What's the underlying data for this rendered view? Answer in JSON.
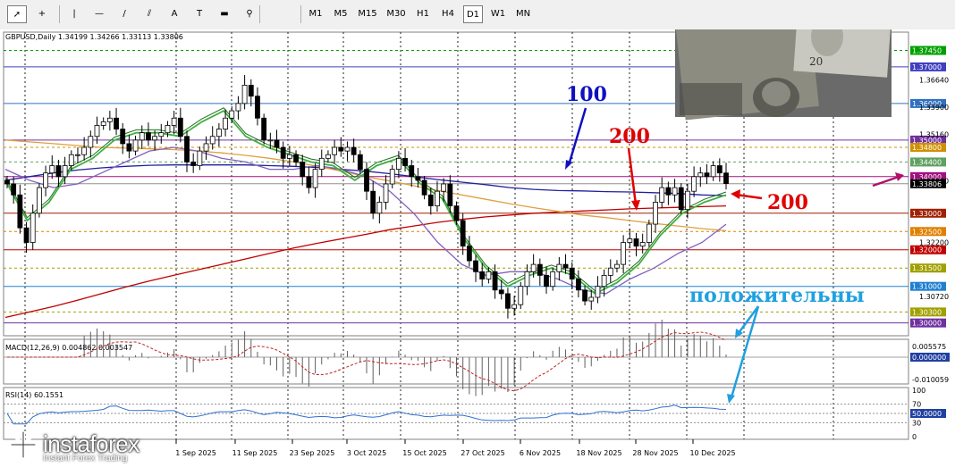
{
  "toolbar": {
    "tools": [
      {
        "name": "cursor-tool",
        "glyph": "➚"
      },
      {
        "name": "crosshair-tool",
        "glyph": "+"
      },
      {
        "name": "vertical-line-tool",
        "glyph": "|"
      },
      {
        "name": "horizontal-line-tool",
        "glyph": "—"
      },
      {
        "name": "trendline-tool",
        "glyph": "/"
      },
      {
        "name": "channel-tool",
        "glyph": "⫽"
      },
      {
        "name": "text-tool",
        "glyph": "A"
      },
      {
        "name": "text-label-tool",
        "glyph": "T"
      },
      {
        "name": "arrow-shapes-tool",
        "glyph": "▬"
      },
      {
        "name": "more-shapes-tool",
        "glyph": "⚲"
      }
    ],
    "timeframes": [
      "M1",
      "M5",
      "M15",
      "M30",
      "H1",
      "H4",
      "D1",
      "W1",
      "MN"
    ],
    "active_timeframe": "D1"
  },
  "header": {
    "symbol_line": "GBPUSD,Daily  1.34199 1.34266 1.33113 1.33806"
  },
  "macd_label": "MACD(12,26,9) 0.004862 0.003547",
  "rsi_label": "RSI(14) 60.1551",
  "annotations": {
    "ma100": "100",
    "ma200_top": "200",
    "ma200_right": "200",
    "positive": "положительны"
  },
  "watermark": {
    "brand": "instaforex",
    "tagline": "Instant Forex Trading"
  },
  "chart_data": {
    "type": "candlestick",
    "symbol": "GBPUSD",
    "timeframe": "Daily",
    "last_ohlc": {
      "open": 1.34199,
      "high": 1.34266,
      "low": 1.33113,
      "close": 1.33806
    },
    "x_tick_labels": [
      "1 Sep 2025",
      "11 Sep 2025",
      "23 Sep 2025",
      "3 Oct 2025",
      "15 Oct 2025",
      "27 Oct 2025",
      "6 Nov 2025",
      "18 Nov 2025",
      "28 Nov 2025",
      "10 Dec 2025"
    ],
    "y_tick_labels": [
      "1.36640",
      "1.33900",
      "1.35160",
      "1.33880",
      "1.32200",
      "1.30720"
    ],
    "ylim": [
      1.2965,
      1.3795
    ],
    "horizontal_levels": [
      {
        "price": 1.3745,
        "label": "1.37450",
        "color": "#00a000",
        "style": "dash"
      },
      {
        "price": 1.37,
        "label": "1.37000",
        "color": "#4040c0",
        "style": "solid"
      },
      {
        "price": 1.36,
        "label": "1.36000",
        "color": "#3070c0",
        "style": "solid"
      },
      {
        "price": 1.35,
        "label": "1.35000",
        "color": "#7030a0",
        "style": "solid"
      },
      {
        "price": 1.348,
        "label": "1.34800",
        "color": "#d09000",
        "style": "dash"
      },
      {
        "price": 1.344,
        "label": "1.34400",
        "color": "#60a060",
        "style": "dash"
      },
      {
        "price": 1.34,
        "label": "1.34000",
        "color": "#a01080",
        "style": "solid"
      },
      {
        "price": 1.33,
        "label": "1.33000",
        "color": "#a02000",
        "style": "solid"
      },
      {
        "price": 1.325,
        "label": "1.32500",
        "color": "#e08000",
        "style": "dash"
      },
      {
        "price": 1.32,
        "label": "1.32000",
        "color": "#c00000",
        "style": "solid"
      },
      {
        "price": 1.315,
        "label": "1.31500",
        "color": "#a0a000",
        "style": "dash"
      },
      {
        "price": 1.31,
        "label": "1.31000",
        "color": "#2080d0",
        "style": "solid"
      },
      {
        "price": 1.303,
        "label": "1.30300",
        "color": "#a0a000",
        "style": "dash"
      },
      {
        "price": 1.3,
        "label": "1.30000",
        "color": "#7030a0",
        "style": "solid"
      }
    ],
    "current_price": {
      "price": 1.33806,
      "label": "1.33806"
    },
    "close_series": [
      1.338,
      1.335,
      1.326,
      1.322,
      1.33,
      1.337,
      1.341,
      1.343,
      1.34,
      1.343,
      1.346,
      1.346,
      1.348,
      1.351,
      1.354,
      1.355,
      1.356,
      1.353,
      1.349,
      1.347,
      1.35,
      1.352,
      1.35,
      1.351,
      1.352,
      1.354,
      1.356,
      1.351,
      1.344,
      1.343,
      1.347,
      1.349,
      1.351,
      1.353,
      1.356,
      1.358,
      1.36,
      1.365,
      1.362,
      1.356,
      1.35,
      1.35,
      1.348,
      1.345,
      1.346,
      1.344,
      1.34,
      1.337,
      1.342,
      1.345,
      1.346,
      1.348,
      1.347,
      1.348,
      1.346,
      1.342,
      1.336,
      1.33,
      1.333,
      1.338,
      1.342,
      1.345,
      1.343,
      1.34,
      1.339,
      1.335,
      1.332,
      1.336,
      1.338,
      1.332,
      1.328,
      1.321,
      1.317,
      1.314,
      1.312,
      1.314,
      1.309,
      1.308,
      1.304,
      1.305,
      1.31,
      1.314,
      1.316,
      1.313,
      1.31,
      1.314,
      1.316,
      1.315,
      1.312,
      1.309,
      1.306,
      1.307,
      1.31,
      1.313,
      1.315,
      1.316,
      1.322,
      1.323,
      1.321,
      1.322,
      1.327,
      1.333,
      1.337,
      1.335,
      1.337,
      1.331,
      1.336,
      1.34,
      1.341,
      1.34,
      1.343,
      1.341,
      1.3381
    ],
    "series": [
      {
        "name": "",
        "color": "#2020a0",
        "values": [
          1.339,
          1.34,
          1.341,
          1.3418,
          1.3424,
          1.3428,
          1.3431,
          1.3432,
          1.3432,
          1.3432,
          1.3432,
          1.343,
          1.3428,
          1.3425,
          1.342,
          1.3415,
          1.3408,
          1.34,
          1.3392,
          1.3385,
          1.3378,
          1.337,
          1.3365,
          1.3362,
          1.3361,
          1.3359,
          1.3358,
          1.3356,
          1.3354,
          1.335,
          1.3348
        ]
      },
      {
        "name": "",
        "color": "#c00000",
        "values": [
          1.3015,
          1.303,
          1.3045,
          1.3062,
          1.308,
          1.3098,
          1.3115,
          1.313,
          1.3145,
          1.316,
          1.3175,
          1.319,
          1.3205,
          1.3218,
          1.323,
          1.3242,
          1.3255,
          1.3265,
          1.3275,
          1.3283,
          1.329,
          1.3295,
          1.33,
          1.3303,
          1.3306,
          1.3309,
          1.3312,
          1.3314,
          1.3316,
          1.3318,
          1.332
        ]
      },
      {
        "name": "",
        "color": "#e0a040",
        "values": [
          1.35,
          1.3495,
          1.349,
          1.3485,
          1.348,
          1.3478,
          1.3476,
          1.3474,
          1.347,
          1.3465,
          1.3458,
          1.345,
          1.344,
          1.3428,
          1.3415,
          1.34,
          1.3388,
          1.3375,
          1.3362,
          1.335,
          1.3338,
          1.3326,
          1.3315,
          1.3305,
          1.3295,
          1.3288,
          1.328,
          1.3272,
          1.3265,
          1.3258,
          1.3252
        ]
      },
      {
        "name": "",
        "color": "#8060c0",
        "values": [
          1.342,
          1.339,
          1.337,
          1.338,
          1.341,
          1.344,
          1.347,
          1.348,
          1.347,
          1.345,
          1.344,
          1.342,
          1.342,
          1.343,
          1.342,
          1.34,
          1.336,
          1.33,
          1.322,
          1.316,
          1.313,
          1.314,
          1.314,
          1.312,
          1.309,
          1.308,
          1.312,
          1.315,
          1.319,
          1.322,
          1.327
        ]
      },
      {
        "name": "",
        "color": "#40b040",
        "values": [
          1.339,
          1.328,
          1.333,
          1.342,
          1.345,
          1.35,
          1.352,
          1.352,
          1.351,
          1.355,
          1.358,
          1.351,
          1.348,
          1.346,
          1.344,
          1.343,
          1.339,
          1.343,
          1.345,
          1.338,
          1.334,
          1.323,
          1.315,
          1.31,
          1.313,
          1.315,
          1.313,
          1.308,
          1.311,
          1.316,
          1.324,
          1.33,
          1.333,
          1.335
        ]
      }
    ],
    "macd": {
      "main": 0.004862,
      "signal": 0.003547,
      "ticks": [
        "0.005575",
        "0.000000",
        "-0.010059"
      ]
    },
    "rsi": {
      "value": 60.1551,
      "ticks": [
        "100",
        "70",
        "50.0000",
        "30",
        "0"
      ],
      "levels": [
        70,
        50,
        30
      ]
    }
  }
}
